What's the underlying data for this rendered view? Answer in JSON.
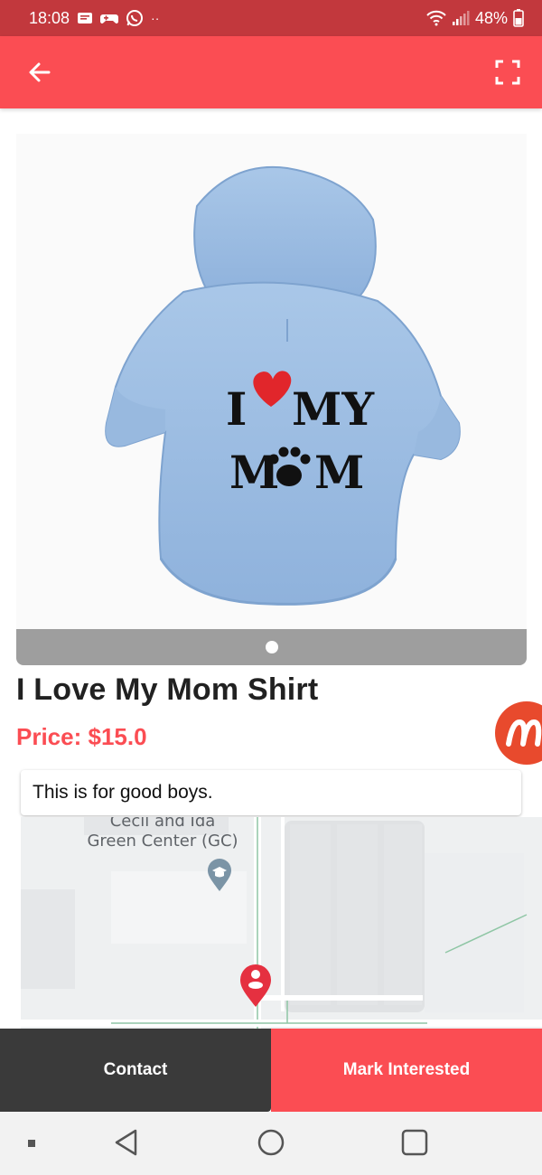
{
  "status_bar": {
    "time": "18:08",
    "more": "··",
    "battery": "48%",
    "icons": [
      "message-icon",
      "game-controller-icon",
      "whatsapp-icon",
      "wifi-icon",
      "signal-icon",
      "battery-icon"
    ]
  },
  "app_bar": {
    "back_icon": "arrow-left-icon",
    "fullscreen_icon": "fullscreen-icon",
    "color": "#fb4d53"
  },
  "product": {
    "image_text_line1": "I",
    "image_text_line1b": "MY",
    "image_text_line2a": "M",
    "image_text_line2b": "M",
    "image_count": 1,
    "active_image": 1,
    "title": "I Love My Mom Shirt",
    "price": "Price: $15.0",
    "description": "This is for good boys."
  },
  "map": {
    "place_line1": "Cecil and Ida",
    "place_line2": "Green Center (GC)"
  },
  "actions": {
    "contact": "Contact",
    "mark_interested": "Mark Interested"
  },
  "colors": {
    "accent": "#fb4d53",
    "status_bar": "#c2383d",
    "contact_button": "#3a3a3a"
  }
}
